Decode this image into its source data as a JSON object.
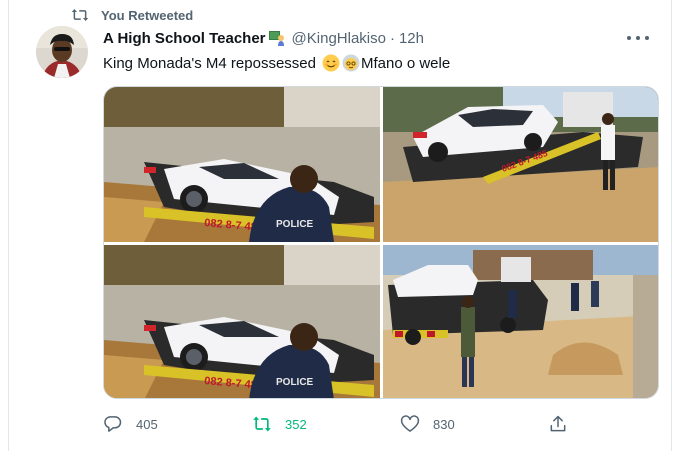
{
  "retweet_banner": {
    "text": "You Retweeted",
    "icon": "retweet-icon"
  },
  "tweet": {
    "display_name": "A High School Teacher",
    "name_emoji": "teacher-emoji",
    "handle": "@KingHlakiso",
    "separator": "·",
    "time": "12h",
    "text_before": "King Monada's M4 repossessed",
    "text_emojis": [
      "smiling-face-emoji",
      "old-person-emoji"
    ],
    "text_after": "Mfano o wele"
  },
  "photos": [
    {
      "name": "tow-truck-bmw-closeup",
      "truck_text": "082 8-7 485",
      "vest_text": "POLICE"
    },
    {
      "name": "tow-truck-bmw-street",
      "truck_text": "082 8-7 485"
    },
    {
      "name": "tow-truck-bmw-closeup-duplicate",
      "truck_text": "082 8-7 485",
      "vest_text": "POLICE"
    },
    {
      "name": "tow-truck-bmw-wide",
      "truck_text": ""
    }
  ],
  "actions": {
    "reply": {
      "icon": "reply-icon",
      "count": "405"
    },
    "retweet": {
      "icon": "retweet-icon",
      "count": "352",
      "color": "#00ba7c"
    },
    "like": {
      "icon": "heart-icon",
      "count": "830"
    },
    "share": {
      "icon": "share-icon"
    }
  },
  "colors": {
    "text_primary": "#0f1419",
    "text_secondary": "#536471",
    "retweet_green": "#00ba7c",
    "border": "#cfd9de"
  }
}
